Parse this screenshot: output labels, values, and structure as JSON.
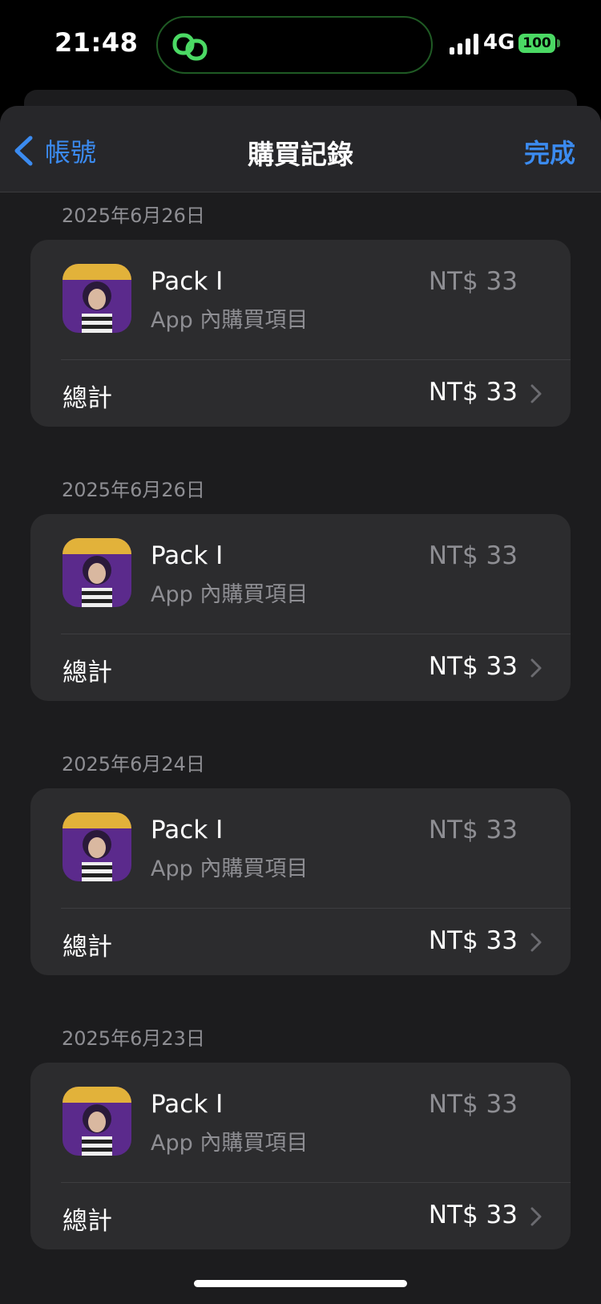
{
  "status_bar": {
    "time": "21:48",
    "network": "4G",
    "battery": "100",
    "island_icon": "link-chain-icon",
    "island_color": "#4bd964"
  },
  "nav": {
    "back_label": "帳號",
    "title": "購買記錄",
    "done_label": "完成",
    "accent_color": "#3b8bf0"
  },
  "purchases": [
    {
      "date": "2025年6月26日",
      "item_name": "Pack I",
      "item_type": "App 內購買項目",
      "item_price": "NT$ 33",
      "total_label": "總計",
      "total_price": "NT$ 33"
    },
    {
      "date": "2025年6月26日",
      "item_name": "Pack I",
      "item_type": "App 內購買項目",
      "item_price": "NT$ 33",
      "total_label": "總計",
      "total_price": "NT$ 33"
    },
    {
      "date": "2025年6月24日",
      "item_name": "Pack I",
      "item_type": "App 內購買項目",
      "item_price": "NT$ 33",
      "total_label": "總計",
      "total_price": "NT$ 33"
    },
    {
      "date": "2025年6月23日",
      "item_name": "Pack I",
      "item_type": "App 內購買項目",
      "item_price": "NT$ 33",
      "total_label": "總計",
      "total_price": "NT$ 33"
    }
  ]
}
